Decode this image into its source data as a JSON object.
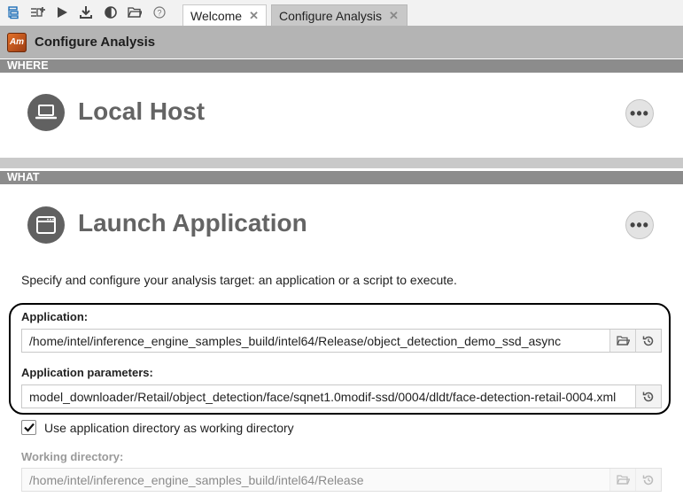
{
  "toolbar": {
    "icons": [
      "project-navigator-icon",
      "new-analysis-icon",
      "run-icon",
      "download-icon",
      "compare-icon",
      "open-result-icon",
      "help-icon"
    ]
  },
  "tabs": [
    {
      "label": "Welcome",
      "active": false
    },
    {
      "label": "Configure Analysis",
      "active": true
    }
  ],
  "titlebar": {
    "logo_text": "Am",
    "title": "Configure Analysis"
  },
  "where": {
    "section_label": "WHERE",
    "heading": "Local Host"
  },
  "what": {
    "section_label": "WHAT",
    "heading": "Launch Application",
    "description": "Specify and configure your analysis target: an application or a script to execute."
  },
  "form": {
    "application_label": "Application:",
    "application_value": "/home/intel/inference_engine_samples_build/intel64/Release/object_detection_demo_ssd_async",
    "parameters_label": "Application parameters:",
    "parameters_value": "model_downloader/Retail/object_detection/face/sqnet1.0modif-ssd/0004/dldt/face-detection-retail-0004.xml",
    "use_app_dir_checked": true,
    "use_app_dir_label": "Use application directory as working directory",
    "working_dir_label": "Working directory:",
    "working_dir_value": "/home/intel/inference_engine_samples_build/intel64/Release"
  },
  "colors": {
    "section_bar": "#8c8c8c",
    "titlebar": "#b4b4b4",
    "heading_icon": "#616161",
    "highlight_border": "#000000"
  }
}
